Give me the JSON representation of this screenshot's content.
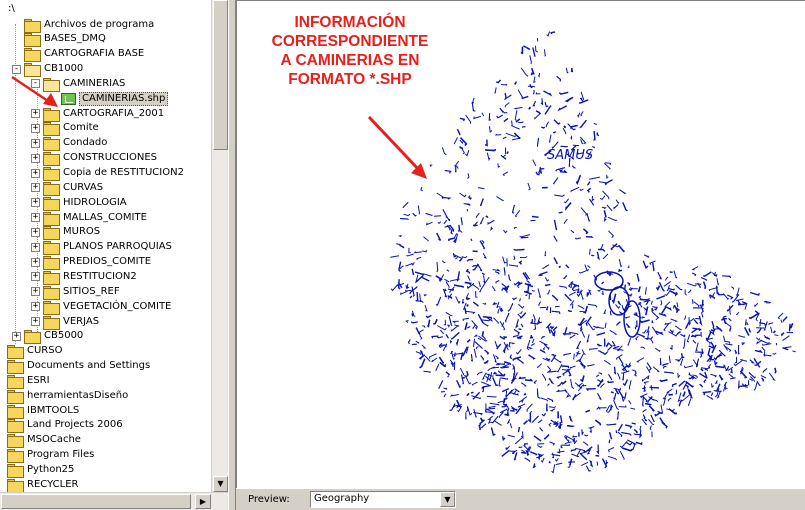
{
  "tree": {
    "root_label": ":\\",
    "items": [
      {
        "label": "Archivos de programa",
        "depth": 0,
        "expander": "",
        "icon": "folder-icon"
      },
      {
        "label": "BASES_DMQ",
        "depth": 0,
        "expander": "",
        "icon": "folder-icon"
      },
      {
        "label": "CARTOGRAFIA BASE",
        "depth": 0,
        "expander": "",
        "icon": "folder-icon"
      },
      {
        "label": "CB1000",
        "depth": 0,
        "expander": "−",
        "icon": "folder-open-icon"
      },
      {
        "label": "CAMINERIAS",
        "depth": 1,
        "expander": "−",
        "icon": "folder-open-icon"
      },
      {
        "label": "CAMINERIAS.shp",
        "depth": 2,
        "expander": "",
        "icon": "shapefile-icon",
        "selected": true
      },
      {
        "label": "CARTOGRAFIA_2001",
        "depth": 1,
        "expander": "+",
        "icon": "folder-icon"
      },
      {
        "label": "Comite",
        "depth": 1,
        "expander": "+",
        "icon": "folder-icon"
      },
      {
        "label": "Condado",
        "depth": 1,
        "expander": "+",
        "icon": "folder-icon"
      },
      {
        "label": "CONSTRUCCIONES",
        "depth": 1,
        "expander": "+",
        "icon": "folder-icon"
      },
      {
        "label": "Copia de RESTITUCION2",
        "depth": 1,
        "expander": "+",
        "icon": "folder-icon"
      },
      {
        "label": "CURVAS",
        "depth": 1,
        "expander": "+",
        "icon": "folder-icon"
      },
      {
        "label": "HIDROLOGIA",
        "depth": 1,
        "expander": "+",
        "icon": "folder-icon"
      },
      {
        "label": "MALLAS_COMITE",
        "depth": 1,
        "expander": "+",
        "icon": "folder-icon"
      },
      {
        "label": "MUROS",
        "depth": 1,
        "expander": "+",
        "icon": "folder-icon"
      },
      {
        "label": "PLANOS PARROQUIAS",
        "depth": 1,
        "expander": "+",
        "icon": "folder-icon"
      },
      {
        "label": "PREDIOS_COMITE",
        "depth": 1,
        "expander": "+",
        "icon": "folder-icon"
      },
      {
        "label": "RESTITUCION2",
        "depth": 1,
        "expander": "+",
        "icon": "folder-icon"
      },
      {
        "label": "SITIOS_REF",
        "depth": 1,
        "expander": "+",
        "icon": "folder-icon"
      },
      {
        "label": "VEGETACIÓN_COMITE",
        "depth": 1,
        "expander": "+",
        "icon": "folder-icon"
      },
      {
        "label": "VERJAS",
        "depth": 1,
        "expander": "+",
        "icon": "folder-icon"
      },
      {
        "label": "CB5000",
        "depth": 0,
        "expander": "+",
        "icon": "folder-icon"
      },
      {
        "label": "CURSO",
        "depth": -1,
        "expander": "",
        "icon": "folder-icon"
      },
      {
        "label": "Documents and Settings",
        "depth": -1,
        "expander": "",
        "icon": "folder-icon"
      },
      {
        "label": "ESRI",
        "depth": -1,
        "expander": "",
        "icon": "folder-icon"
      },
      {
        "label": "herramientasDiseño",
        "depth": -1,
        "expander": "",
        "icon": "folder-icon"
      },
      {
        "label": "IBMTOOLS",
        "depth": -1,
        "expander": "",
        "icon": "folder-icon"
      },
      {
        "label": "Land Projects 2006",
        "depth": -1,
        "expander": "",
        "icon": "folder-icon"
      },
      {
        "label": "MSOCache",
        "depth": -1,
        "expander": "",
        "icon": "folder-icon"
      },
      {
        "label": "Program Files",
        "depth": -1,
        "expander": "",
        "icon": "folder-icon"
      },
      {
        "label": "Python25",
        "depth": -1,
        "expander": "",
        "icon": "folder-icon"
      },
      {
        "label": "RECYCLER",
        "depth": -1,
        "expander": "",
        "icon": "folder-icon"
      }
    ]
  },
  "annotation": {
    "lines": [
      "INFORMACIÓN",
      "CORRESPONDIENTE",
      "A CAMINERIAS EN",
      "FORMATO *.SHP"
    ],
    "color": "#e8201c"
  },
  "map": {
    "feature_color": "#0a14b4",
    "extra_text": "SAMUS"
  },
  "preview_bar": {
    "label": "Preview:",
    "selected": "Geography"
  }
}
